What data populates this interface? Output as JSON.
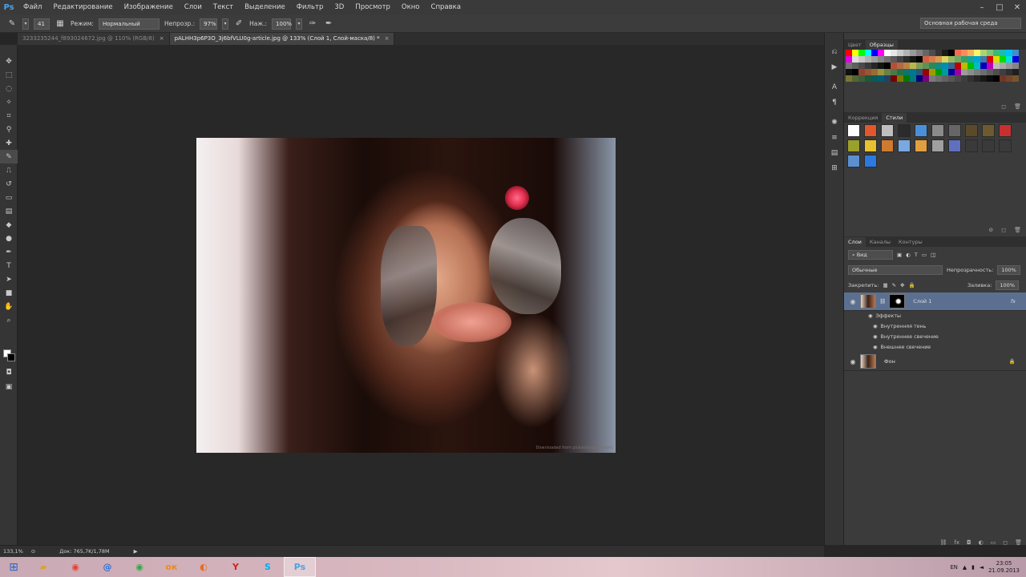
{
  "app": {
    "logo": "Ps"
  },
  "menu": [
    "Файл",
    "Редактирование",
    "Изображение",
    "Слои",
    "Текст",
    "Выделение",
    "Фильтр",
    "3D",
    "Просмотр",
    "Окно",
    "Справка"
  ],
  "window_controls": {
    "minimize": "–",
    "maximize": "□",
    "close": "✕"
  },
  "options": {
    "brush_size": "41",
    "mode_label": "Режим:",
    "mode_value": "Нормальный",
    "opacity_label": "Непрозр.:",
    "opacity_value": "97%",
    "pressure_label": "Наж.:",
    "pressure_value": "100%",
    "workspace": "Основная рабочая среда"
  },
  "tabs": [
    {
      "label": "3233235244_f893024672.jpg @ 110% (RGB/8)",
      "active": false
    },
    {
      "label": "pALHH3p6P3O_3j6bfVLU0g-article.jpg @ 133% (Слой 1, Слой-маска/8) *",
      "active": true
    }
  ],
  "canvas": {
    "watermark": "Downloaded from pickwallpapers.com"
  },
  "panels": {
    "swatches_tabs": [
      "Цвет",
      "Образцы"
    ],
    "styles_tabs": [
      "Коррекция",
      "Стили"
    ],
    "layers_tabs": [
      "Слои",
      "Каналы",
      "Контуры"
    ],
    "kind_filter": "Вид",
    "blend_mode": "Обычные",
    "opacity_label": "Непрозрачность:",
    "opacity_value": "100%",
    "lock_label": "Закрепить:",
    "fill_label": "Заливка:",
    "fill_value": "100%",
    "layers": [
      {
        "name": "Слой 1",
        "selected": true,
        "fx": "fx"
      },
      {
        "name": "Фон",
        "selected": false
      }
    ],
    "effects_label": "Эффекты",
    "effects": [
      "Внутренняя тень",
      "Внутреннее свечение",
      "Внешнее свечение"
    ]
  },
  "status": {
    "zoom": "133,1%",
    "doc": "Док: 765,7K/1,78M"
  },
  "taskbar": {
    "lang": "EN",
    "time": "23:05",
    "date": "21.09.2013",
    "apps": [
      "explorer-icon",
      "chrome-icon",
      "mail-icon",
      "chrome-alt-icon",
      "odnoklassniki-icon",
      "firefox-icon",
      "yandex-icon",
      "skype-icon",
      "photoshop-icon"
    ]
  },
  "colors": {
    "accent_selection": "#5b6f91",
    "eye_glow": "#e2304f",
    "ps_blue": "#4aa3e6"
  }
}
